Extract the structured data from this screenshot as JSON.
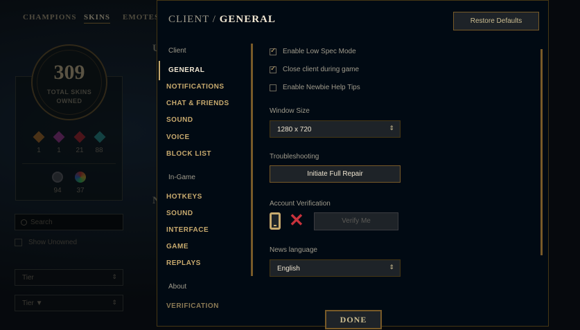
{
  "background": {
    "tabs": [
      "CHAMPIONS",
      "SKINS",
      "EMOTES"
    ],
    "active_tab": "SKINS",
    "skins_count": "309",
    "skins_label_line1": "TOTAL SKINS",
    "skins_label_line2": "OWNED",
    "gem_counts": [
      "1",
      "1",
      "21",
      "88"
    ],
    "orb_counts": [
      "94",
      "37"
    ],
    "search_placeholder": "Search",
    "show_unowned": "Show Unowned",
    "tier_select_1": "Tier",
    "tier_select_2": "Tier ▼",
    "partial_letters": [
      "U",
      "N"
    ]
  },
  "modal": {
    "title_prefix": "CLIENT /",
    "title_main": "GENERAL",
    "restore_defaults": "Restore Defaults",
    "done": "DONE"
  },
  "sidenav": {
    "client_label": "Client",
    "client_items": [
      "GENERAL",
      "NOTIFICATIONS",
      "CHAT & FRIENDS",
      "SOUND",
      "VOICE",
      "BLOCK LIST"
    ],
    "ingame_label": "In-Game",
    "ingame_items": [
      "HOTKEYS",
      "SOUND",
      "INTERFACE",
      "GAME",
      "REPLAYS"
    ],
    "about_label": "About",
    "about_items": [
      "VERIFICATION"
    ],
    "active_item": "GENERAL"
  },
  "general": {
    "checkboxes": [
      {
        "label": "Enable Low Spec Mode",
        "checked": true
      },
      {
        "label": "Close client during game",
        "checked": true
      },
      {
        "label": "Enable Newbie Help Tips",
        "checked": false
      }
    ],
    "window_size_label": "Window Size",
    "window_size_value": "1280 x 720",
    "troubleshooting_label": "Troubleshooting",
    "repair_button": "Initiate Full Repair",
    "account_verification_label": "Account Verification",
    "verify_button": "Verify Me",
    "news_language_label": "News language",
    "news_language_value": "English"
  },
  "colors": {
    "gold": "#c8aa6e",
    "gold_dark": "#785a28",
    "error_red": "#c8323c",
    "modal_bg": "#010a13"
  }
}
